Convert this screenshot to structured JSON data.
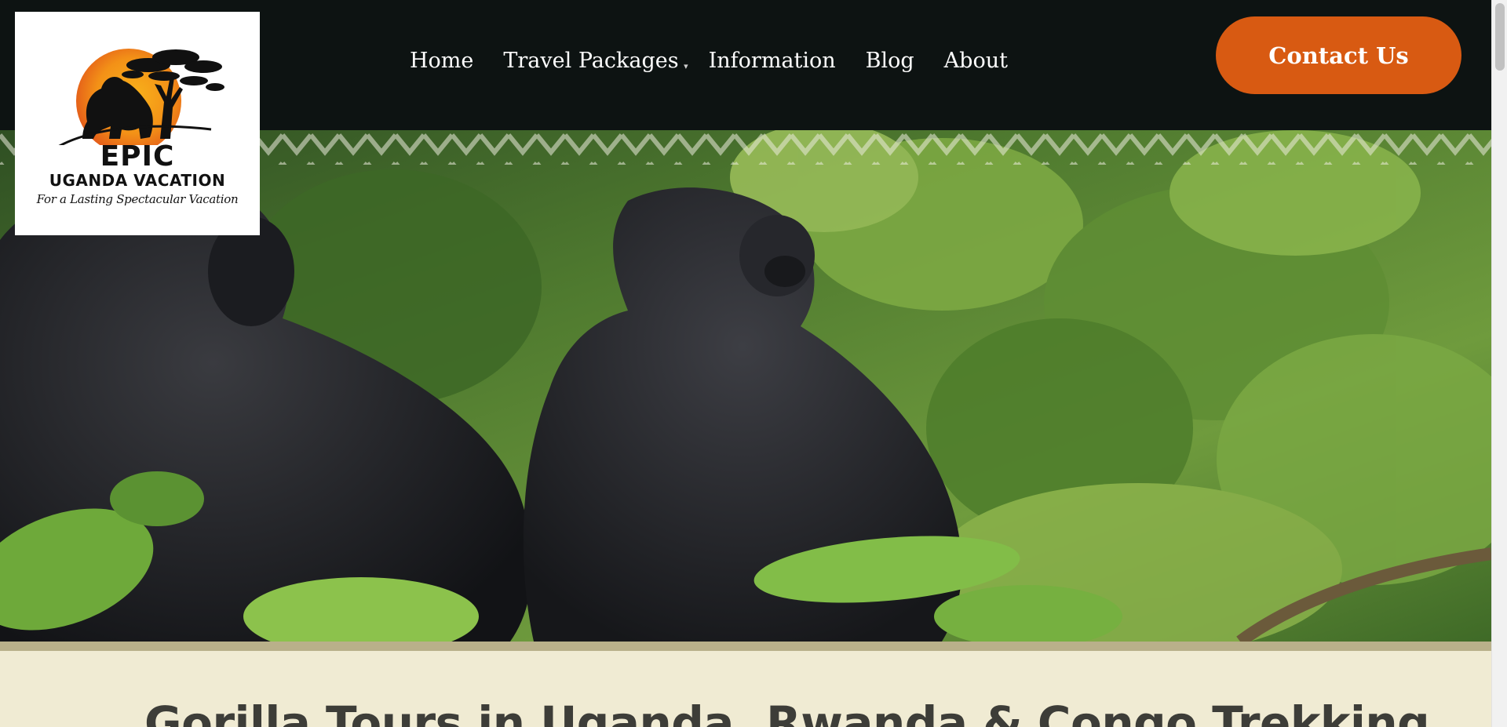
{
  "logo": {
    "line1": "EPIC",
    "line2": "UGANDA VACATION",
    "tagline": "For a Lasting Spectacular Vacation",
    "icon": "gorilla-sunset-tree-logo"
  },
  "nav": {
    "items": [
      {
        "label": "Home"
      },
      {
        "label": "Travel Packages",
        "has_dropdown": true
      },
      {
        "label": "Information"
      },
      {
        "label": "Blog"
      },
      {
        "label": "About"
      }
    ]
  },
  "header": {
    "contact_label": "Contact Us"
  },
  "hero": {
    "image": "gorillas-in-forest-photo"
  },
  "intro": {
    "title": "Gorilla Tours in Uganda, Rwanda & Congo Trekking"
  },
  "colors": {
    "header_bg": "#0d1312",
    "accent": "#d85a12",
    "section_bg": "#f0ebd3",
    "heading_text": "#3d3d38"
  }
}
